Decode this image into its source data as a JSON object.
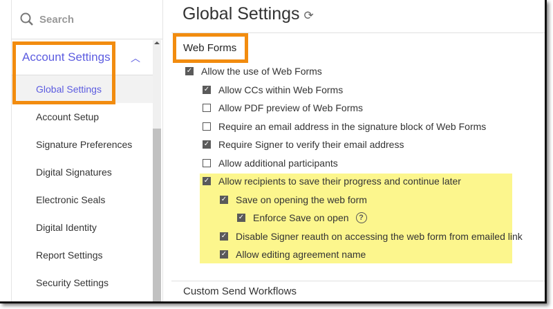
{
  "sidebar": {
    "search_placeholder": "Search",
    "section": "Account Settings",
    "active": "Global Settings",
    "items": [
      "Account Setup",
      "Signature Preferences",
      "Digital Signatures",
      "Electronic Seals",
      "Digital Identity",
      "Report Settings",
      "Security Settings"
    ]
  },
  "main": {
    "title": "Global Settings",
    "section": "Web Forms",
    "next_section": "Custom Send Workflows",
    "options": [
      {
        "label": "Allow the use of Web Forms",
        "checked": true,
        "level": 0
      },
      {
        "label": "Allow CCs within Web Forms",
        "checked": true,
        "level": 1
      },
      {
        "label": "Allow PDF preview of Web Forms",
        "checked": false,
        "level": 1
      },
      {
        "label": "Require an email address in the signature block of Web Forms",
        "checked": false,
        "level": 1
      },
      {
        "label": "Require Signer to verify their email address",
        "checked": true,
        "level": 1
      },
      {
        "label": "Allow additional participants",
        "checked": false,
        "level": 1
      },
      {
        "label": "Allow recipients to save their progress and continue later",
        "checked": true,
        "level": 1
      },
      {
        "label": "Save on opening the web form",
        "checked": true,
        "level": 2
      },
      {
        "label": "Enforce Save on open",
        "checked": true,
        "level": 3,
        "help": true
      },
      {
        "label": "Disable Signer reauth on accessing the web form from emailed link",
        "checked": true,
        "level": 2
      },
      {
        "label": "Allow editing agreement name",
        "checked": true,
        "level": 2
      }
    ]
  },
  "colors": {
    "accent": "#5c5ce0",
    "highlight": "#fcf68d",
    "callout": "#f28c0f"
  }
}
